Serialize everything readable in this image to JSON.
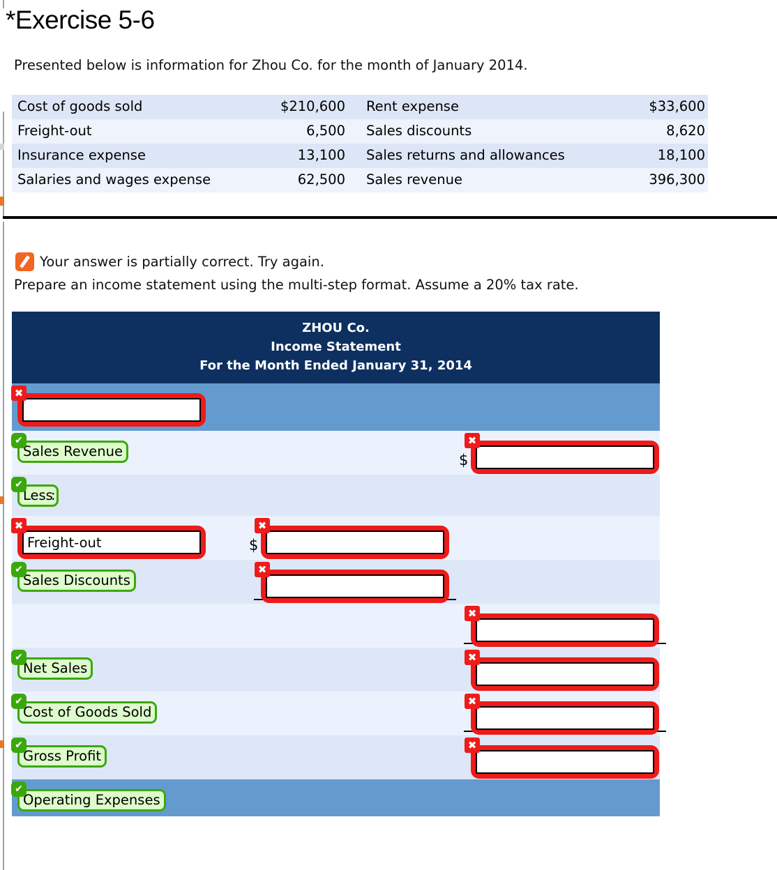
{
  "page": {
    "title": "*Exercise 5-6",
    "intro": "Presented below is information for Zhou Co. for the month of January 2014."
  },
  "given_table": {
    "rows": [
      {
        "label_left": "Cost of goods sold",
        "value_left": "$210,600",
        "label_right": "Rent expense",
        "value_right": "$33,600"
      },
      {
        "label_left": "Freight-out",
        "value_left": "6,500",
        "label_right": "Sales discounts",
        "value_right": "8,620"
      },
      {
        "label_left": "Insurance expense",
        "value_left": "13,100",
        "label_right": "Sales returns and allowances",
        "value_right": "18,100"
      },
      {
        "label_left": "Salaries and wages expense",
        "value_left": "62,500",
        "label_right": "Sales revenue",
        "value_right": "396,300"
      }
    ]
  },
  "feedback": {
    "icon": "pencil-icon",
    "text": "Your answer is partially correct.  Try again.",
    "accent_color": "#f26522"
  },
  "prompt": "Prepare an income statement using the multi-step format. Assume a 20% tax rate.",
  "statement": {
    "header": {
      "company": "ZHOU Co.",
      "report": "Income Statement",
      "period": "For the Month Ended January 31, 2014",
      "background_color": "#0d3060"
    },
    "colors": {
      "band": "#649bce",
      "row_dark": "#dde7f7",
      "row_light": "#ebf2fd",
      "correct": "#3aa80c",
      "incorrect": "#ee1b1b"
    },
    "badges": {
      "correct": "✔",
      "incorrect": "✖"
    },
    "currency_symbol": "$",
    "rows": [
      {
        "label": "",
        "label_status": "incorrect",
        "mid": null,
        "right": null,
        "band": true
      },
      {
        "label": "Sales Revenue",
        "label_status": "correct",
        "mid": null,
        "right": "",
        "right_status": "incorrect",
        "right_dollar": true
      },
      {
        "label": "Less",
        "label_status": "correct",
        "suffix": ":",
        "mid": null,
        "right": null
      },
      {
        "label": "Freight-out",
        "label_status": "incorrect",
        "mid": "",
        "mid_status": "incorrect",
        "mid_dollar": true,
        "right": null
      },
      {
        "label": "Sales Discounts",
        "label_status": "correct",
        "mid": "",
        "mid_status": "incorrect",
        "mid_rule": true,
        "right": null
      },
      {
        "label": null,
        "mid": null,
        "right": "",
        "right_status": "incorrect",
        "right_rule": true
      },
      {
        "label": "Net Sales",
        "label_status": "correct",
        "mid": null,
        "right": "",
        "right_status": "incorrect"
      },
      {
        "label": "Cost of Goods Sold",
        "label_status": "correct",
        "mid": null,
        "right": "",
        "right_status": "incorrect",
        "right_rule": true
      },
      {
        "label": "Gross Profit",
        "label_status": "correct",
        "mid": null,
        "right": "",
        "right_status": "incorrect"
      },
      {
        "label": "Operating Expenses",
        "label_status": "correct",
        "mid": null,
        "right": null,
        "band": true
      }
    ]
  }
}
